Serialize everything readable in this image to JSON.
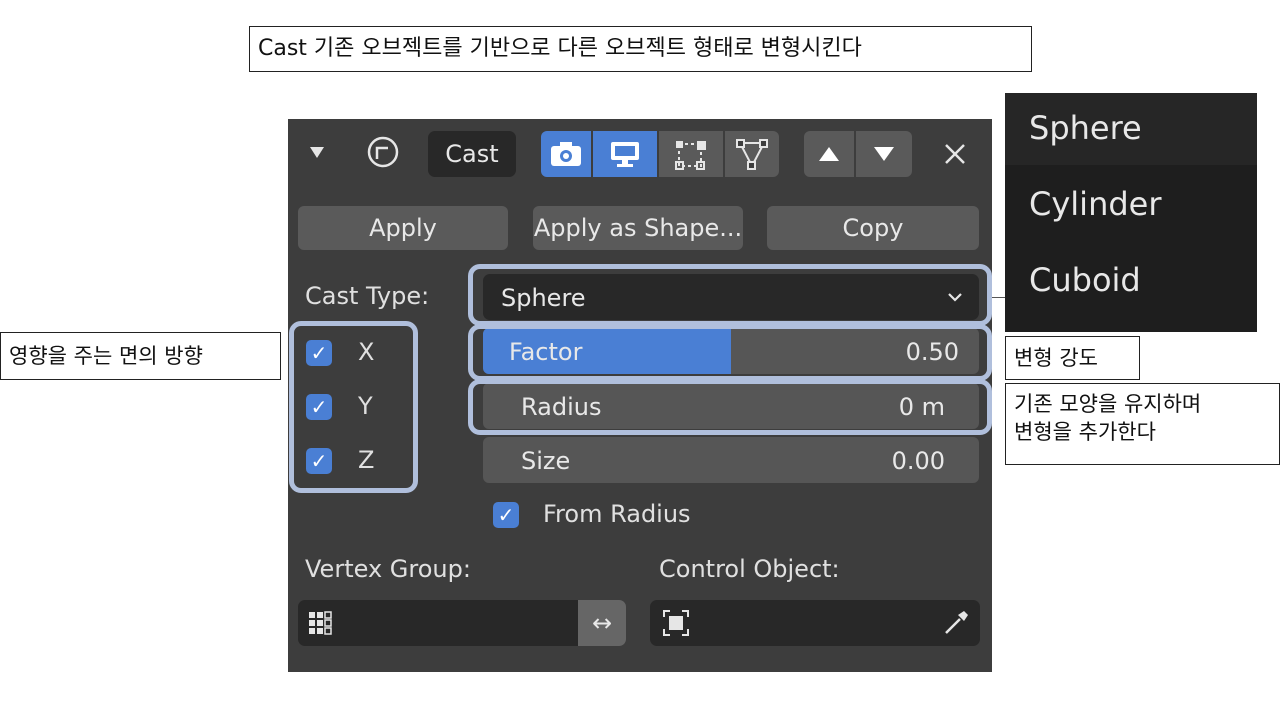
{
  "callouts": {
    "top": "Cast 기존 오브젝트를 기반으로 다른 오브젝트 형태로 변형시킨다",
    "left": "영향을 주는 면의 방향",
    "factor": "변형 강도",
    "radius_line1": "기존 모양을 유지하며",
    "radius_line2": "변형을 추가한다"
  },
  "header": {
    "collapse_icon": "triangle-down-icon",
    "modifier_icon": "cast-modifier-icon",
    "name": "Cast",
    "toggles": [
      "camera-icon",
      "display-icon",
      "editmode-icon",
      "vertex-icon"
    ],
    "move_up_icon": "arrow-up-icon",
    "move_down_icon": "arrow-down-icon",
    "close_icon": "close-icon"
  },
  "actions": {
    "apply": "Apply",
    "apply_as_shape": "Apply as Shape...",
    "copy": "Copy"
  },
  "cast_type": {
    "label": "Cast Type:",
    "value": "Sphere"
  },
  "axes": [
    {
      "label": "X",
      "checked": true
    },
    {
      "label": "Y",
      "checked": true
    },
    {
      "label": "Z",
      "checked": true
    }
  ],
  "factor": {
    "label": "Factor",
    "value": "0.50",
    "fill_fraction": 0.5
  },
  "radius": {
    "label": "Radius",
    "value": "0 m"
  },
  "size": {
    "label": "Size",
    "value": "0.00"
  },
  "from_radius": {
    "label": "From Radius",
    "checked": true
  },
  "vertex_group": {
    "label": "Vertex Group:",
    "value": "",
    "invert_symbol": "↔"
  },
  "control_object": {
    "label": "Control Object:",
    "value": ""
  },
  "dropdown_options": [
    "Sphere",
    "Cylinder",
    "Cuboid"
  ],
  "colors": {
    "panel_bg": "#3d3d3d",
    "accent": "#4a7fd4",
    "highlight_border": "#b0bfdc"
  }
}
